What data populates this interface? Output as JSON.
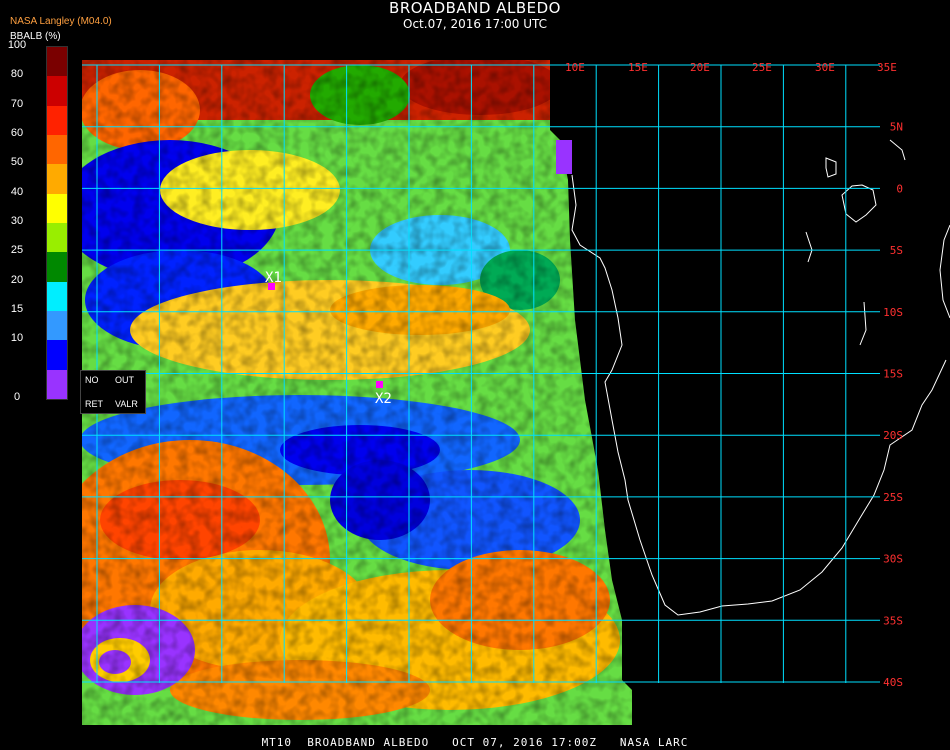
{
  "title": "BROADBAND ALBEDO",
  "subtitle": "Oct.07, 2016 17:00 UTC",
  "source_label": "NASA Langley (M04.0)",
  "units_label": "BBALB (%)",
  "footer": "MT10  BROADBAND ALBEDO   OCT 07, 2016 17:00Z   NASA LARC",
  "colorbar": {
    "ticks": [
      "100",
      "80",
      "70",
      "60",
      "50",
      "40",
      "30",
      "25",
      "20",
      "15",
      "10",
      "0"
    ],
    "colors": [
      "#7a0000",
      "#cc0000",
      "#ff2200",
      "#ff6600",
      "#ffaa00",
      "#ffff00",
      "#99ee00",
      "#008800",
      "#00eeff",
      "#3399ff",
      "#0000ff",
      "#9933ff"
    ]
  },
  "legend_box": {
    "no": "NO",
    "out": "OUT",
    "ret": "RET",
    "valr": "VALR"
  },
  "markers": [
    {
      "label": "X1"
    },
    {
      "label": "X2"
    }
  ],
  "longitude_labels": [
    "10E",
    "15E",
    "20E",
    "25E",
    "30E",
    "35E"
  ],
  "latitude_labels": [
    "5N",
    "0",
    "5S",
    "10S",
    "15S",
    "20S",
    "25S",
    "30S",
    "35S",
    "40S"
  ],
  "colors": {
    "grid": "#00e0ff",
    "grid_label": "#ff3030",
    "coast": "#ffffff",
    "marker": "#ff00ff"
  }
}
